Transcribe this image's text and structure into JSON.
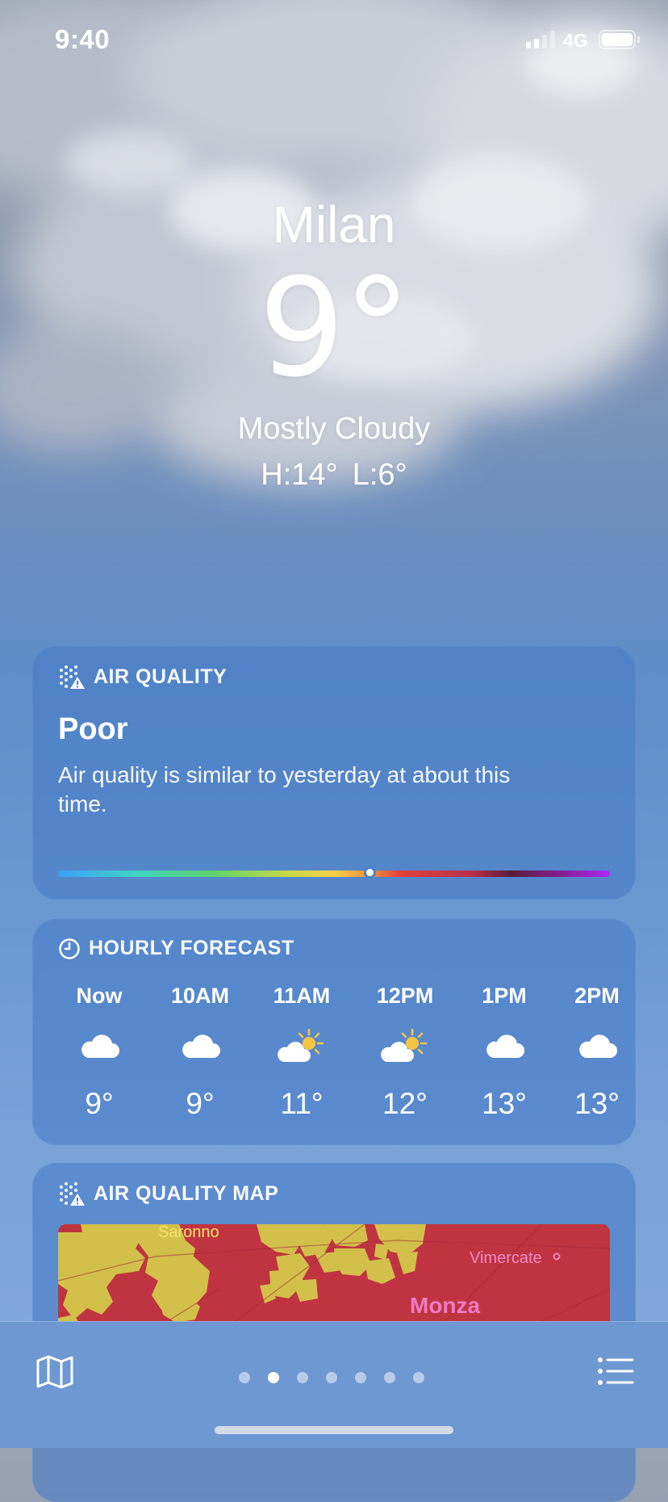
{
  "status_bar": {
    "time": "9:40",
    "network": "4G",
    "signal_bars_active": 2,
    "signal_bars_total": 4
  },
  "location": {
    "city": "Milan",
    "temperature": "9°",
    "condition": "Mostly Cloudy",
    "high": "H:14°",
    "low": "L:6°"
  },
  "air_quality": {
    "header": "AIR QUALITY",
    "level": "Poor",
    "description": "Air quality is similar to yesterday at about this time.",
    "scale_position": 0.565
  },
  "hourly": {
    "header": "HOURLY FORECAST",
    "items": [
      {
        "time": "Now",
        "icon": "cloud-icon",
        "temp": "9°"
      },
      {
        "time": "10AM",
        "icon": "cloud-icon",
        "temp": "9°"
      },
      {
        "time": "11AM",
        "icon": "partly-sunny-icon",
        "temp": "11°"
      },
      {
        "time": "12PM",
        "icon": "partly-sunny-icon",
        "temp": "12°"
      },
      {
        "time": "1PM",
        "icon": "cloud-icon",
        "temp": "13°"
      },
      {
        "time": "2PM",
        "icon": "cloud-icon",
        "temp": "13°"
      }
    ]
  },
  "air_quality_map": {
    "header": "AIR QUALITY MAP",
    "labels": {
      "saronno": "Saronno",
      "vimercate": "Vimercate",
      "monza": "Monza"
    },
    "colors": {
      "poor": "#c03441",
      "moderate": "#d2c04a"
    }
  },
  "bottom_bar": {
    "page_count": 7,
    "active_page": 2
  },
  "colors": {
    "card": "#487dc6",
    "sun": "#f5c542"
  }
}
